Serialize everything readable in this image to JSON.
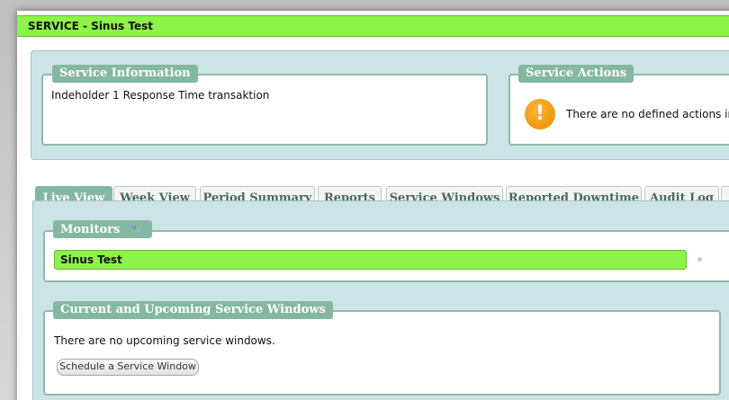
{
  "title_bar": {
    "text": "SERVICE - Sinus Test"
  },
  "service_information": {
    "legend": "Service Information",
    "text": "Indeholder 1 Response Time transaktion"
  },
  "service_actions": {
    "legend": "Service Actions",
    "icon": "warning-icon",
    "text": "There are no defined actions in this service"
  },
  "tabs": [
    {
      "label": "Live View",
      "active": true
    },
    {
      "label": "Week View",
      "active": false
    },
    {
      "label": "Period Summary",
      "active": false
    },
    {
      "label": "Reports",
      "active": false
    },
    {
      "label": "Service Windows",
      "active": false
    },
    {
      "label": "Reported Downtime",
      "active": false
    },
    {
      "label": "Audit Log",
      "active": false
    }
  ],
  "monitors": {
    "legend": "Monitors",
    "edit_icon": "wrench-icon",
    "items": [
      {
        "name": "Sinus Test",
        "status_color": "#8df249"
      }
    ]
  },
  "service_windows": {
    "legend": "Current and Upcoming Service Windows",
    "text": "There are no upcoming service windows.",
    "button_label": "Schedule a Service Window"
  },
  "colors": {
    "accent_green": "#8df249",
    "legend_green": "#85b8a1",
    "panel_bg": "#cde4e6",
    "warning_orange": "#f0a020"
  }
}
